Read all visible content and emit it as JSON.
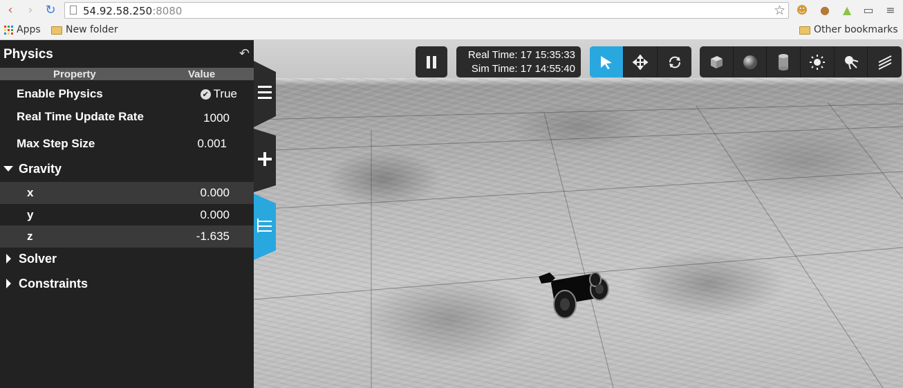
{
  "browser": {
    "url_host": "54.92.58.250",
    "url_port": ":8080",
    "bookmarks": {
      "apps": "Apps",
      "new_folder": "New folder",
      "other": "Other bookmarks"
    }
  },
  "panel": {
    "title": "Physics",
    "column_property": "Property",
    "column_value": "Value",
    "rows": [
      {
        "label": "Enable Physics",
        "value": "True"
      },
      {
        "label": "Real Time Update Rate",
        "value": "1000"
      },
      {
        "label": "Max Step Size",
        "value": "0.001"
      }
    ],
    "gravity": {
      "label": "Gravity",
      "x_label": "x",
      "x_value": "0.000",
      "y_label": "y",
      "y_value": "0.000",
      "z_label": "z",
      "z_value": "-1.635"
    },
    "solver": "Solver",
    "constraints": "Constraints"
  },
  "clock": {
    "real_time": "Real Time: 17 15:35:33",
    "sim_time": "Sim Time: 17 14:55:40"
  },
  "colors": {
    "accent": "#29a8e0",
    "panel_bg": "#222222",
    "toolbar_bg": "#2b2b2b"
  }
}
